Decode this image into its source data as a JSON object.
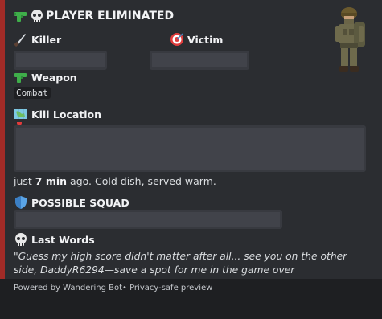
{
  "embed": {
    "accent_color": "#a12b27",
    "title": "PLAYER ELIMINATED",
    "title_icons": [
      "gun-icon",
      "skull-icon"
    ],
    "thumbnail": "soldier-avatar"
  },
  "fields": {
    "killer": {
      "icon": "knife-icon",
      "label": "Killer"
    },
    "victim": {
      "icon": "target-icon",
      "label": "Victim"
    },
    "weapon": {
      "icon": "gun-icon",
      "label": "Weapon",
      "value": "Combat"
    },
    "kill_location": {
      "icon": "map-icon",
      "label": "Kill Location"
    },
    "time": {
      "prefix": "just ",
      "bold": "7 min",
      "suffix": " ago. Cold dish, served warm."
    },
    "squad": {
      "icon": "shield-icon",
      "label": "POSSIBLE SQUAD"
    },
    "last_words": {
      "icon": "skull-icon",
      "label": "Last Words",
      "quote": "\"Guess my high score didn't matter after all... see you on the other side, DaddyR6294—save a spot for me in the game over"
    }
  },
  "footer": {
    "text": "Powered by Wandering Bot• Privacy-safe preview"
  }
}
